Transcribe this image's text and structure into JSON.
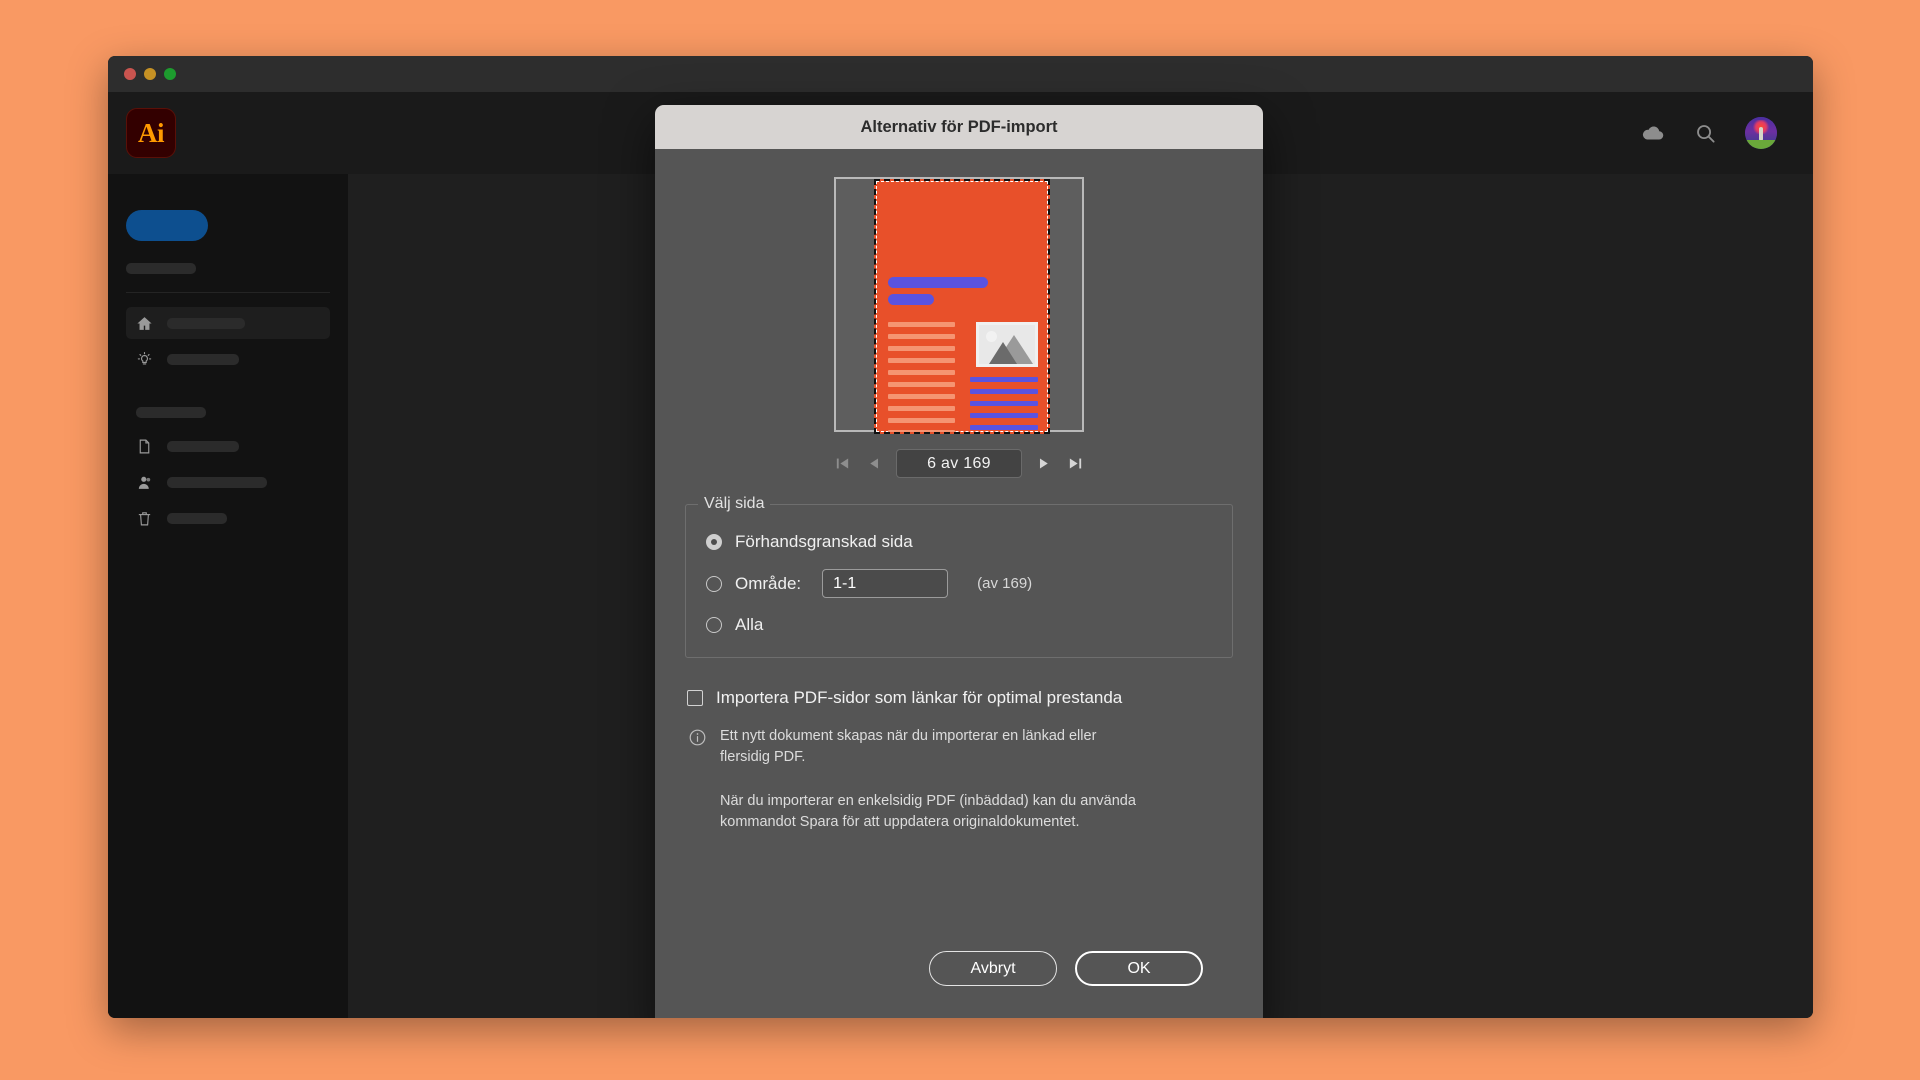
{
  "desktop": {
    "background_color": "#f99963"
  },
  "window": {
    "traffic_lights": [
      "close",
      "minimize",
      "zoom"
    ]
  },
  "app": {
    "logo_text": "Ai",
    "brand_color": "#ff9a00",
    "sidebar": {
      "primary_button_color": "#0d4f8f",
      "items": [
        {
          "icon": "home-icon",
          "active": true
        },
        {
          "icon": "lightbulb-icon",
          "active": false
        },
        {
          "icon": "document-icon",
          "active": false
        },
        {
          "icon": "person-icon",
          "active": false
        },
        {
          "icon": "trash-icon",
          "active": false
        }
      ]
    },
    "header": {
      "icons": [
        "cloud-icon",
        "search-icon",
        "avatar"
      ]
    }
  },
  "dialog": {
    "title": "Alternativ för PDF-import",
    "preview": {
      "page_background_color": "#e8502a",
      "accent_color": "#5a53e0",
      "text_line_color": "#f59472"
    },
    "page_nav": {
      "first_label": "first-page",
      "prev_label": "previous-page",
      "value": "6 av 169",
      "next_label": "next-page",
      "last_label": "last-page"
    },
    "page_select": {
      "legend": "Välj sida",
      "options": [
        {
          "label": "Förhandsgranskad sida",
          "selected": true
        },
        {
          "label": "Område:",
          "selected": false
        },
        {
          "label": "Alla",
          "selected": false
        }
      ],
      "range_value": "1-1",
      "range_note": "(av 169)"
    },
    "link_option": {
      "label": "Importera PDF-sidor som länkar för optimal prestanda",
      "checked": false
    },
    "info": {
      "paragraph_1": "Ett nytt dokument skapas när du importerar en länkad eller flersidig PDF.",
      "paragraph_2": "När du importerar en enkelsidig PDF (inbäddad) kan du använda kommandot Spara för att uppdatera originaldokumentet."
    },
    "footer": {
      "cancel_label": "Avbryt",
      "ok_label": "OK"
    }
  }
}
